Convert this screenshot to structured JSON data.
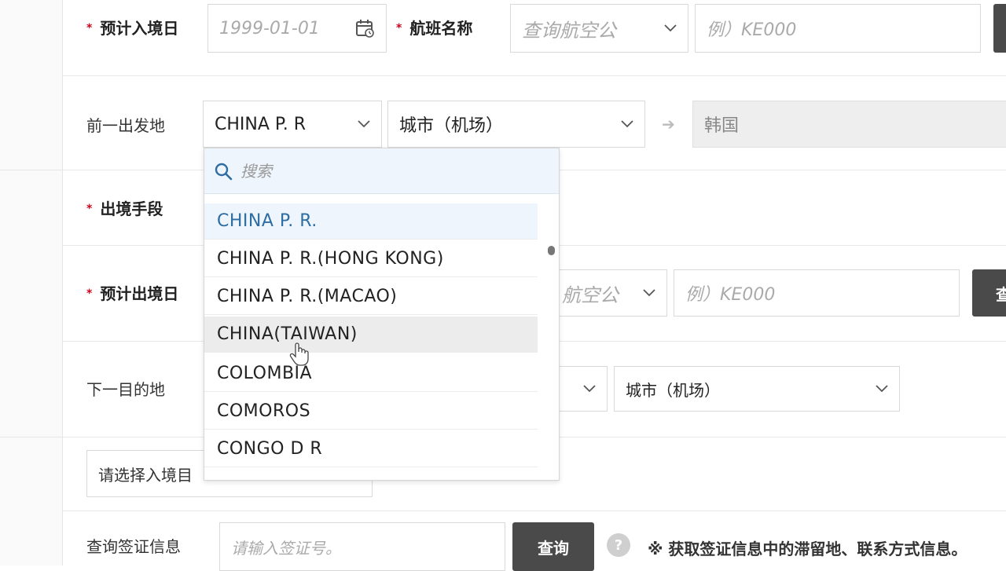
{
  "form": {
    "entry_date": {
      "label": "预计入境日",
      "placeholder": "1999-01-01"
    },
    "flight_name": {
      "label": "航班名称",
      "airline_placeholder": "查询航空公",
      "flight_placeholder": "例）KE000"
    },
    "prev_departure": {
      "label": "前一出发地",
      "country_value": "CHINA P. R",
      "city_value": "城市（机场）",
      "destination_value": "韩国"
    },
    "exit_means": {
      "label": "出境手段"
    },
    "exit_date": {
      "label": "预计出境日",
      "airline_placeholder": "航空公",
      "flight_placeholder": "例）KE000",
      "button_label": "查"
    },
    "next_destination": {
      "label": "下一目的地",
      "city_value": "城市（机场）"
    },
    "entry_purpose": {
      "placeholder": "请选择入境目"
    },
    "visa_query": {
      "label": "查询签证信息",
      "placeholder": "请输入签证号。",
      "button_label": "查询",
      "help_label": "?",
      "note": "※ 获取签证信息中的滞留地、联系方式信息。"
    }
  },
  "dropdown": {
    "search_placeholder": "搜索",
    "options": [
      {
        "label": "CHINA P. R.",
        "state": "selected"
      },
      {
        "label": "CHINA P. R.(HONG KONG)",
        "state": "normal"
      },
      {
        "label": "CHINA P. R.(MACAO)",
        "state": "normal"
      },
      {
        "label": "CHINA(TAIWAN)",
        "state": "hover"
      },
      {
        "label": "COLOMBIA",
        "state": "normal"
      },
      {
        "label": "COMOROS",
        "state": "normal"
      },
      {
        "label": "CONGO D R",
        "state": "normal"
      }
    ]
  },
  "colors": {
    "accent_blue": "#2d6da3",
    "required_star": "#d0021b",
    "dark_button": "#4a4a4a"
  },
  "icons": [
    "calendar-icon",
    "chevron-down-icon",
    "search-icon",
    "arrow-right-icon",
    "help-icon",
    "hand-cursor-icon"
  ]
}
